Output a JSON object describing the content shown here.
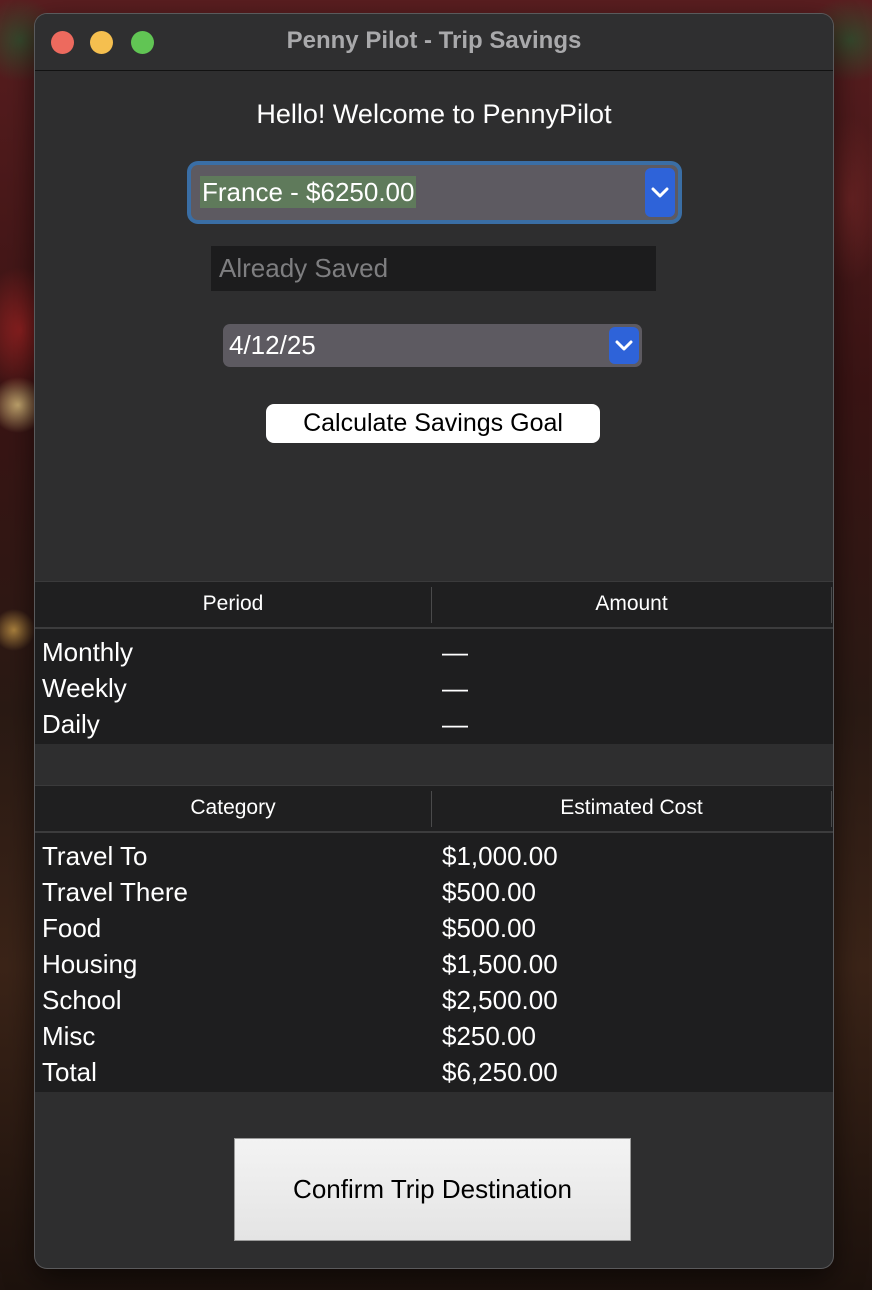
{
  "window": {
    "title": "Penny Pilot - Trip Savings"
  },
  "welcome_text": "Hello! Welcome to PennyPilot",
  "destination_select": {
    "selected": "France - $6250.00",
    "icon": "chevron-down-icon"
  },
  "already_saved": {
    "value": "",
    "placeholder": "Already Saved"
  },
  "date_select": {
    "selected": "4/12/25",
    "icon": "chevron-down-icon"
  },
  "calculate_button": "Calculate Savings Goal",
  "savings_table": {
    "headers": [
      "Period",
      "Amount"
    ],
    "rows": [
      {
        "period": "Monthly",
        "amount": "—"
      },
      {
        "period": "Weekly",
        "amount": "—"
      },
      {
        "period": "Daily",
        "amount": "—"
      }
    ]
  },
  "cost_table": {
    "headers": [
      "Category",
      "Estimated Cost"
    ],
    "rows": [
      {
        "category": "Travel To",
        "cost": "$1,000.00"
      },
      {
        "category": "Travel There",
        "cost": "$500.00"
      },
      {
        "category": "Food",
        "cost": "$500.00"
      },
      {
        "category": "Housing",
        "cost": "$1,500.00"
      },
      {
        "category": "School",
        "cost": "$2,500.00"
      },
      {
        "category": "Misc",
        "cost": "$250.00"
      },
      {
        "category": "Total",
        "cost": "$6,250.00"
      }
    ]
  },
  "confirm_button": "Confirm Trip Destination",
  "colors": {
    "window_bg": "#2e2e2f",
    "accent_blue": "#2e63d9",
    "selection_green": "#5f7a5b",
    "close": "#ed6a5e",
    "minimize": "#f5bf4f",
    "zoom": "#61c554"
  }
}
